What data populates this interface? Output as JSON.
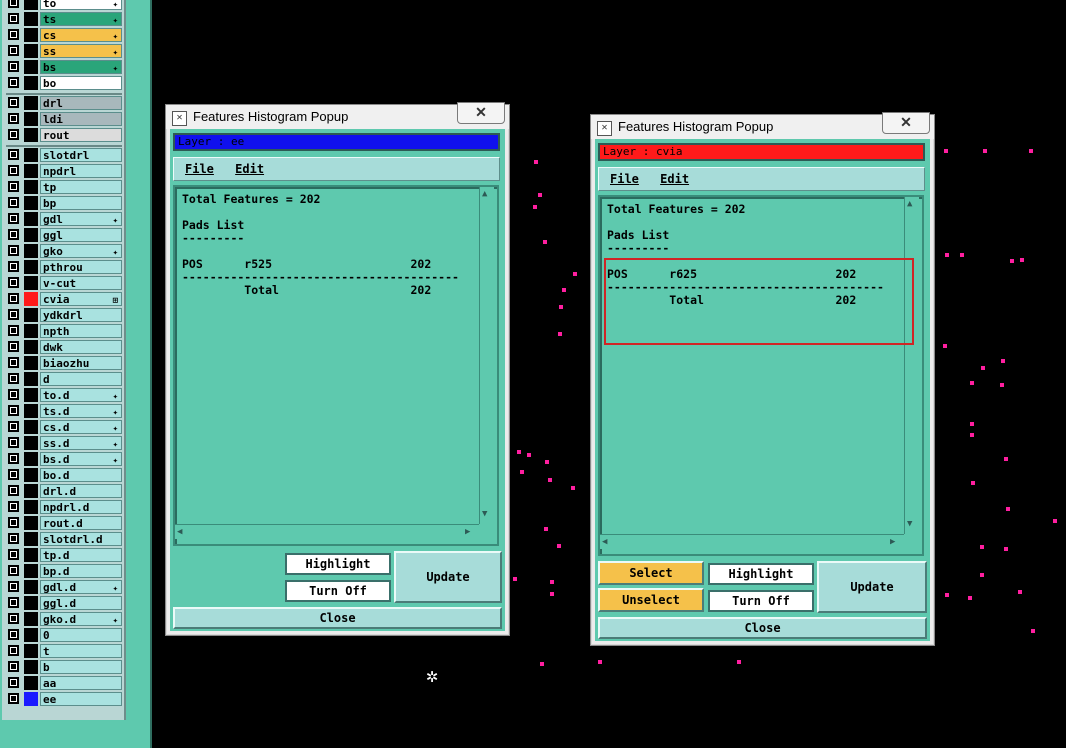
{
  "layers": [
    {
      "name": "to",
      "color": "#ffffff",
      "mark": "✦"
    },
    {
      "name": "ts",
      "color": "#2aa57a",
      "mark": "✦"
    },
    {
      "name": "cs",
      "color": "#f5c14a",
      "mark": "✦"
    },
    {
      "name": "ss",
      "color": "#f5c14a",
      "mark": "✦"
    },
    {
      "name": "bs",
      "color": "#2aa57a",
      "mark": "✦"
    },
    {
      "name": "bo",
      "color": "#ffffff",
      "mark": ""
    },
    {
      "name": "drl",
      "color": "#a8b8bc",
      "mark": ""
    },
    {
      "name": "ldi",
      "color": "#a8b8bc",
      "mark": ""
    },
    {
      "name": "rout",
      "color": "#dcdcdc",
      "mark": ""
    },
    {
      "name": "slotdrl",
      "color": "#a9e2e0",
      "mark": ""
    },
    {
      "name": "npdrl",
      "color": "#a9e2e0",
      "mark": ""
    },
    {
      "name": "tp",
      "color": "#a9e2e0",
      "mark": ""
    },
    {
      "name": "bp",
      "color": "#a9e2e0",
      "mark": ""
    },
    {
      "name": "gdl",
      "color": "#a9e2e0",
      "mark": "✦"
    },
    {
      "name": "ggl",
      "color": "#a9e2e0",
      "mark": ""
    },
    {
      "name": "gko",
      "color": "#a9e2e0",
      "mark": "✦"
    },
    {
      "name": "pthrou",
      "color": "#a9e2e0",
      "mark": ""
    },
    {
      "name": "v-cut",
      "color": "#a9e2e0",
      "mark": ""
    },
    {
      "name": "cvia",
      "color": "#a9e2e0",
      "mark": "⊞"
    },
    {
      "name": "ydkdrl",
      "color": "#a9e2e0",
      "mark": ""
    },
    {
      "name": "npth",
      "color": "#a9e2e0",
      "mark": ""
    },
    {
      "name": "dwk",
      "color": "#a9e2e0",
      "mark": ""
    },
    {
      "name": "biaozhu",
      "color": "#a9e2e0",
      "mark": ""
    },
    {
      "name": "d",
      "color": "#a9e2e0",
      "mark": ""
    },
    {
      "name": "to.d",
      "color": "#a9e2e0",
      "mark": "✦"
    },
    {
      "name": "ts.d",
      "color": "#a9e2e0",
      "mark": "✦"
    },
    {
      "name": "cs.d",
      "color": "#a9e2e0",
      "mark": "✦"
    },
    {
      "name": "ss.d",
      "color": "#a9e2e0",
      "mark": "✦"
    },
    {
      "name": "bs.d",
      "color": "#a9e2e0",
      "mark": "✦"
    },
    {
      "name": "bo.d",
      "color": "#a9e2e0",
      "mark": ""
    },
    {
      "name": "drl.d",
      "color": "#a9e2e0",
      "mark": ""
    },
    {
      "name": "npdrl.d",
      "color": "#a9e2e0",
      "mark": ""
    },
    {
      "name": "rout.d",
      "color": "#a9e2e0",
      "mark": ""
    },
    {
      "name": "slotdrl.d",
      "color": "#a9e2e0",
      "mark": ""
    },
    {
      "name": "tp.d",
      "color": "#a9e2e0",
      "mark": ""
    },
    {
      "name": "bp.d",
      "color": "#a9e2e0",
      "mark": ""
    },
    {
      "name": "gdl.d",
      "color": "#a9e2e0",
      "mark": "✦"
    },
    {
      "name": "ggl.d",
      "color": "#a9e2e0",
      "mark": ""
    },
    {
      "name": "gko.d",
      "color": "#a9e2e0",
      "mark": "✦"
    },
    {
      "name": "0",
      "color": "#a9e2e0",
      "mark": ""
    },
    {
      "name": "t",
      "color": "#a9e2e0",
      "mark": ""
    },
    {
      "name": "b",
      "color": "#a9e2e0",
      "mark": ""
    },
    {
      "name": "aa",
      "color": "#a9e2e0",
      "mark": ""
    },
    {
      "name": "ee",
      "color": "#a9e2e0",
      "mark": ""
    }
  ],
  "layer_swatches": {
    "cvia": "#ff1a1a",
    "ee": "#1a1aff"
  },
  "popup1": {
    "title": "Features Histogram Popup",
    "close_x": "✕",
    "layer_label": "Layer :  ee",
    "layer_color": "#1010ee",
    "menu_file": "File",
    "menu_edit": "Edit",
    "content": "Total Features = 202\n\nPads List\n---------\n\nPOS      r525                    202\n----------------------------------------\n         Total                   202",
    "highlight": "Highlight",
    "turn_off": "Turn Off",
    "update": "Update",
    "close": "Close"
  },
  "popup2": {
    "title": "Features Histogram Popup",
    "close_x": "✕",
    "layer_label": "Layer :  cvia",
    "layer_color": "#ff1a1a",
    "menu_file": "File",
    "menu_edit": "Edit",
    "content": "Total Features = 202\n\nPads List\n---------\n\nPOS      r625                    202\n----------------------------------------\n         Total                   202",
    "select": "Select",
    "unselect": "Unselect",
    "highlight": "Highlight",
    "turn_off": "Turn Off",
    "update": "Update",
    "close": "Close"
  },
  "icons": {
    "cursor": "crosshair-star-icon",
    "window": "app-window-icon"
  }
}
